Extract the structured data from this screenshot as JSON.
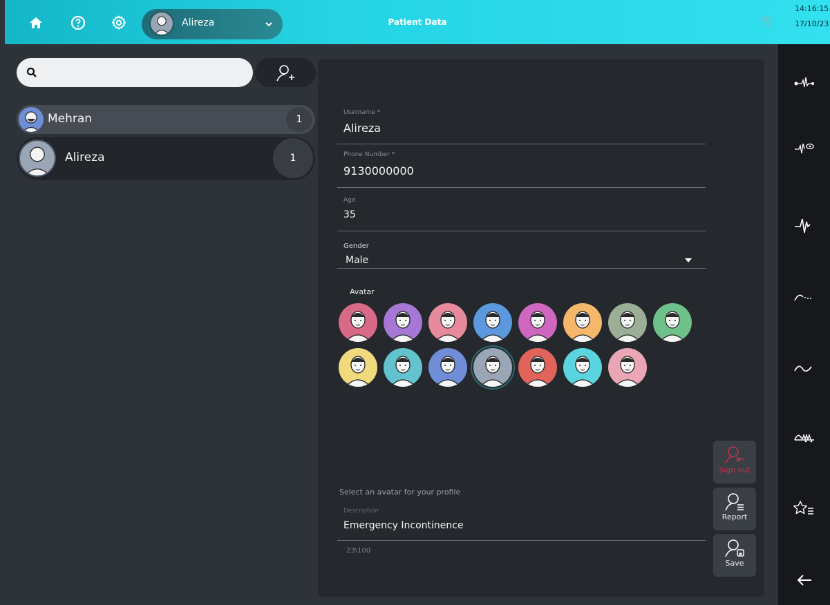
{
  "topbar": {
    "title": "Patient Data",
    "user_name": "Alireza",
    "time": "14:16:15",
    "date": "17/10/23"
  },
  "search": {
    "placeholder": "",
    "value": ""
  },
  "patients": [
    {
      "name": "Mehran",
      "count": "1"
    },
    {
      "name": "Alireza",
      "count": "1"
    }
  ],
  "form": {
    "username_label": "Username *",
    "username_value": "Alireza",
    "phone_label": "Phone Number *",
    "phone_value": "9130000000",
    "age_label": "Age",
    "age_value": "35",
    "gender_label": "Gender",
    "gender_value": "Male",
    "avatar_label": "Avatar",
    "avatar_hint": "Select an avatar for your profile",
    "description_label": "Description",
    "description_value": "Emergency Incontinence",
    "description_counter": "23\\100"
  },
  "actions": {
    "signout": "Sign out",
    "report": "Report",
    "save": "Save"
  },
  "avatars": {
    "selected_index": 11,
    "colors": [
      "#d96a87",
      "#a777d6",
      "#e78b9c",
      "#5b98dd",
      "#cf66c0",
      "#f5b86b",
      "#9aaf95",
      "#6fc18a",
      "#f1da7e",
      "#62c3cf",
      "#6f8ed7",
      "#9aa6b6",
      "#e0645a",
      "#5ad5df",
      "#eaa6b4"
    ]
  },
  "colors": {
    "accent": "#25d4e4",
    "danger": "#c2324a",
    "panel": "#25282d"
  }
}
